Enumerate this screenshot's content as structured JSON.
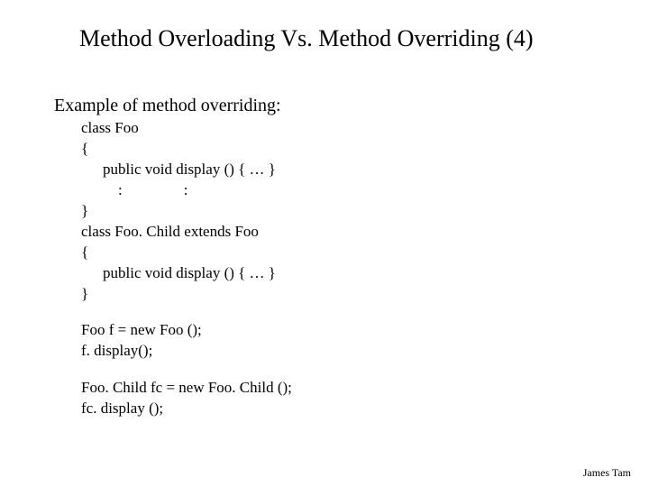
{
  "title": "Method Overloading Vs. Method Overriding (4)",
  "subtitle": "Example of method overriding:",
  "code": {
    "l1": "class Foo",
    "l2": "{",
    "l3": "public void display () { … }",
    "l4": "    :                :",
    "l5": "}",
    "l6": "class Foo. Child extends Foo",
    "l7": "{",
    "l8": "public void display () { … }",
    "l9": "}"
  },
  "usage1": {
    "l1": "Foo f = new Foo ();",
    "l2": "f. display();"
  },
  "usage2": {
    "l1": "Foo. Child fc = new Foo. Child ();",
    "l2": "fc. display ();"
  },
  "footer": "James Tam"
}
